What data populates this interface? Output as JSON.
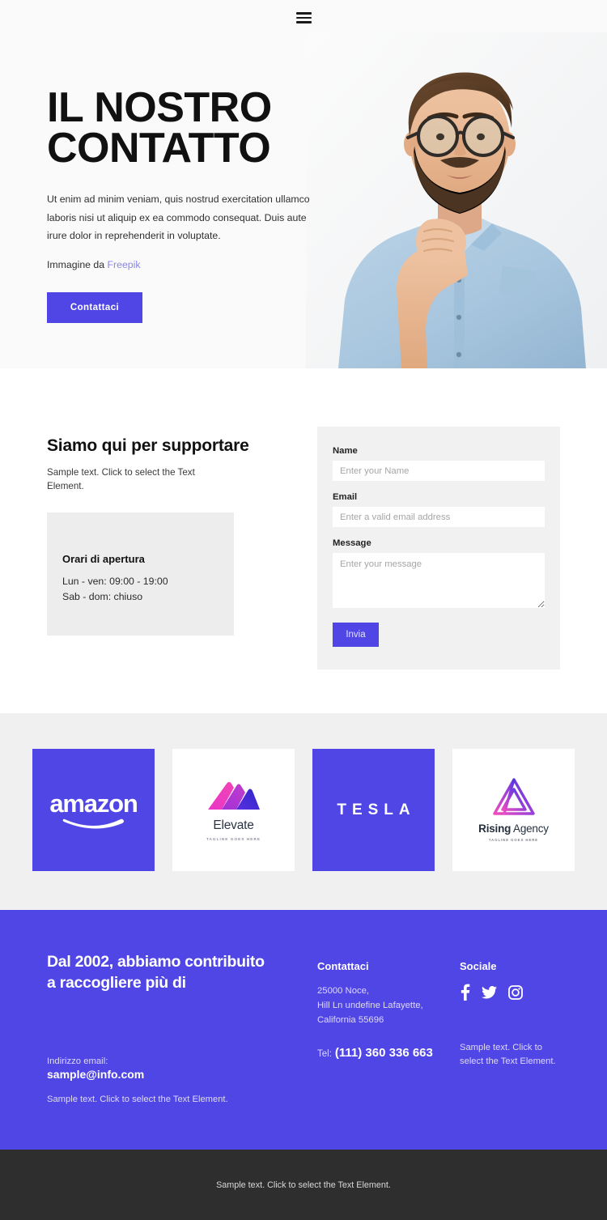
{
  "nav": {
    "menu_icon": "hamburger-menu-icon"
  },
  "hero": {
    "title_line1": "IL NOSTRO",
    "title_line2": "CONTATTO",
    "paragraph": "Ut enim ad minim veniam, quis nostrud exercitation ullamco laboris nisi ut aliquip ex ea commodo consequat. Duis aute irure dolor in reprehenderit in voluptate.",
    "credit_prefix": "Immagine da",
    "credit_link": "Freepik",
    "cta_label": "Contattaci",
    "photo_alt": "bearded-man-with-glasses-photo"
  },
  "support": {
    "heading": "Siamo qui per supportare",
    "subtext": "Sample text. Click to select the Text Element.",
    "hours_title": "Orari di apertura",
    "hours_weekday": "Lun - ven: 09:00 - 19:00",
    "hours_weekend": "Sab - dom: chiuso"
  },
  "form": {
    "name_label": "Name",
    "name_placeholder": "Enter your Name",
    "email_label": "Email",
    "email_placeholder": "Enter a valid email address",
    "message_label": "Message",
    "message_placeholder": "Enter your message",
    "submit_label": "Invia"
  },
  "logos": [
    {
      "name": "amazon",
      "word": "amazon",
      "style": "purple"
    },
    {
      "name": "elevate",
      "word": "Elevate",
      "tagline": "TAGLINE GOES HERE",
      "style": "white"
    },
    {
      "name": "tesla",
      "word": "TESLA",
      "style": "purple"
    },
    {
      "name": "rising-agency",
      "word_bold": "Rising",
      "word_light": "Agency",
      "tagline": "TAGLINE GOES HERE",
      "style": "white"
    }
  ],
  "footer": {
    "headline": "Dal 2002, abbiamo contribuito a raccogliere più di",
    "email_label": "Indirizzo email:",
    "email_value": "sample@info.com",
    "note_left": "Sample text. Click to select the Text Element.",
    "contact_title": "Contattaci",
    "address_line1": "25000 Noce,",
    "address_line2": "Hill Ln undefine Lafayette,",
    "address_line3": "California 55696",
    "tel_label": "Tel:",
    "tel_value": "(111) 360 336 663",
    "social_title": "Sociale",
    "social_icons": [
      "facebook-icon",
      "twitter-icon",
      "instagram-icon"
    ],
    "note_right": "Sample text. Click to select the Text Element."
  },
  "bottombar": {
    "text": "Sample text. Click to select the Text Element."
  },
  "colors": {
    "accent": "#5046e5",
    "link": "#8b87e0",
    "panel_gray": "#f1f1f1",
    "section_gray": "#f0f0f0",
    "card_gray": "#ededed",
    "dark_bar": "#2e2e2e"
  }
}
